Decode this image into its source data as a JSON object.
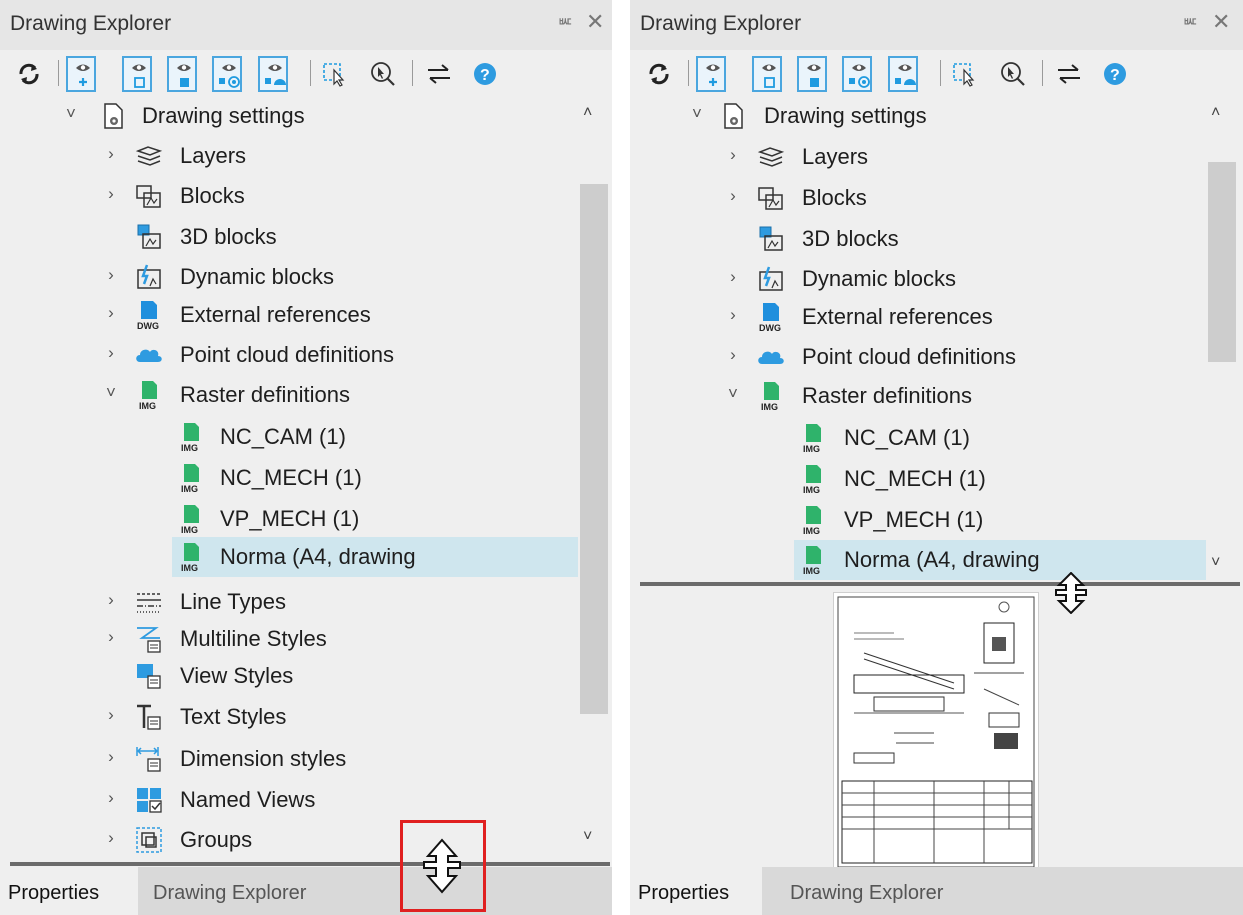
{
  "left_panel": {
    "title": "Drawing Explorer",
    "pin_icon": "ᄣ",
    "close_icon": "✕",
    "tree": [
      {
        "label": "Drawing settings",
        "expander": "˅",
        "icon": "drawing-settings-icon"
      },
      {
        "label": "Layers",
        "expander": "›",
        "icon": "layers-icon"
      },
      {
        "label": "Blocks",
        "expander": "›",
        "icon": "blocks-icon"
      },
      {
        "label": "3D blocks",
        "expander": "",
        "icon": "3d-blocks-icon"
      },
      {
        "label": "Dynamic blocks",
        "expander": "›",
        "icon": "dynamic-blocks-icon"
      },
      {
        "label": "External references",
        "expander": "›",
        "icon": "dwg-file-icon"
      },
      {
        "label": "Point cloud definitions",
        "expander": "›",
        "icon": "cloud-icon"
      },
      {
        "label": "Raster definitions",
        "expander": "˅",
        "icon": "img-file-icon"
      },
      {
        "label": "NC_CAM (1)",
        "expander": "",
        "icon": "img-file-icon"
      },
      {
        "label": "NC_MECH (1)",
        "expander": "",
        "icon": "img-file-icon"
      },
      {
        "label": "VP_MECH (1)",
        "expander": "",
        "icon": "img-file-icon"
      },
      {
        "label": "Norma (A4, drawing",
        "expander": "",
        "icon": "img-file-icon"
      },
      {
        "label": "Line Types",
        "expander": "›",
        "icon": "line-types-icon"
      },
      {
        "label": "Multiline Styles",
        "expander": "›",
        "icon": "multiline-styles-icon"
      },
      {
        "label": "View Styles",
        "expander": "",
        "icon": "view-styles-icon"
      },
      {
        "label": "Text Styles",
        "expander": "›",
        "icon": "text-styles-icon"
      },
      {
        "label": "Dimension styles",
        "expander": "›",
        "icon": "dimension-styles-icon"
      },
      {
        "label": "Named Views",
        "expander": "›",
        "icon": "named-views-icon"
      },
      {
        "label": "Groups",
        "expander": "›",
        "icon": "groups-icon"
      }
    ],
    "scroll_up": "˄",
    "scroll_down": "˅",
    "tabs": [
      {
        "label": "Properties",
        "active": true
      },
      {
        "label": "Drawing Explorer",
        "active": false
      }
    ]
  },
  "right_panel": {
    "title": "Drawing Explorer",
    "pin_icon": "ᄣ",
    "close_icon": "✕",
    "tree": [
      {
        "label": "Drawing settings",
        "expander": "˅",
        "icon": "drawing-settings-icon"
      },
      {
        "label": "Layers",
        "expander": "›",
        "icon": "layers-icon"
      },
      {
        "label": "Blocks",
        "expander": "›",
        "icon": "blocks-icon"
      },
      {
        "label": "3D blocks",
        "expander": "",
        "icon": "3d-blocks-icon"
      },
      {
        "label": "Dynamic blocks",
        "expander": "›",
        "icon": "dynamic-blocks-icon"
      },
      {
        "label": "External references",
        "expander": "›",
        "icon": "dwg-file-icon"
      },
      {
        "label": "Point cloud definitions",
        "expander": "›",
        "icon": "cloud-icon"
      },
      {
        "label": "Raster definitions",
        "expander": "˅",
        "icon": "img-file-icon"
      },
      {
        "label": "NC_CAM (1)",
        "expander": "",
        "icon": "img-file-icon"
      },
      {
        "label": "NC_MECH (1)",
        "expander": "",
        "icon": "img-file-icon"
      },
      {
        "label": "VP_MECH (1)",
        "expander": "",
        "icon": "img-file-icon"
      },
      {
        "label": "Norma (A4, drawing",
        "expander": "",
        "icon": "img-file-icon"
      }
    ],
    "scroll_up": "˄",
    "scroll_down": "˅",
    "tabs": [
      {
        "label": "Properties",
        "active": true
      },
      {
        "label": "Drawing Explorer",
        "active": false
      }
    ]
  },
  "colors": {
    "accent": "#1f9be0",
    "selection": "#cfe6ee",
    "highlight_box": "#e02020",
    "img_green": "#2fb36b",
    "dwg_blue": "#1f8fdd"
  }
}
